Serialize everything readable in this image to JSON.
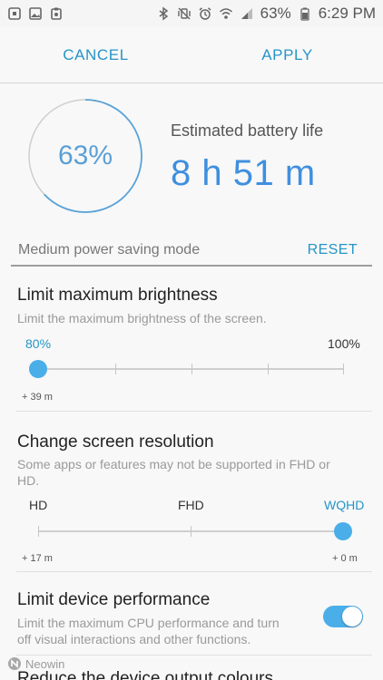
{
  "status_bar": {
    "battery_percent": "63%",
    "time": "6:29 PM",
    "left_icons": [
      "notification-square-icon",
      "image-notification-icon",
      "clipboard-notification-icon"
    ],
    "right_icons": [
      "bluetooth-icon",
      "vibrate-mute-icon",
      "alarm-icon",
      "wifi-icon",
      "signal-icon",
      "battery-icon"
    ]
  },
  "action_bar": {
    "cancel_label": "CANCEL",
    "apply_label": "APPLY"
  },
  "battery": {
    "ring_percent_label": "63%",
    "level": 0.63,
    "estimated_label": "Estimated battery life",
    "estimated_value": "8 h 51 m"
  },
  "mode": {
    "title": "Medium power saving mode",
    "reset_label": "RESET"
  },
  "brightness": {
    "title": "Limit maximum brightness",
    "description": "Limit the maximum brightness of the screen.",
    "min_label": "80%",
    "max_label": "100%",
    "selected_index": 0,
    "steps": 5,
    "delta_label": "+ 39 m"
  },
  "resolution": {
    "title": "Change screen resolution",
    "description_line1": "Some apps or features may not be supported in FHD or",
    "description_line2": "HD.",
    "options": [
      "HD",
      "FHD",
      "WQHD"
    ],
    "selected_index": 2,
    "left_delta": "+ 17 m",
    "right_delta": "+ 0 m"
  },
  "performance": {
    "title": "Limit device performance",
    "description_line1": "Limit the maximum CPU performance and turn",
    "description_line2": "off visual interactions and other functions.",
    "enabled": true
  },
  "next_section_title": "Reduce the device output colours",
  "watermark": "Neowin",
  "colors": {
    "accent": "#2595c7",
    "slider_blue": "#4aaee8",
    "estimate_blue": "#3f8fdf"
  }
}
